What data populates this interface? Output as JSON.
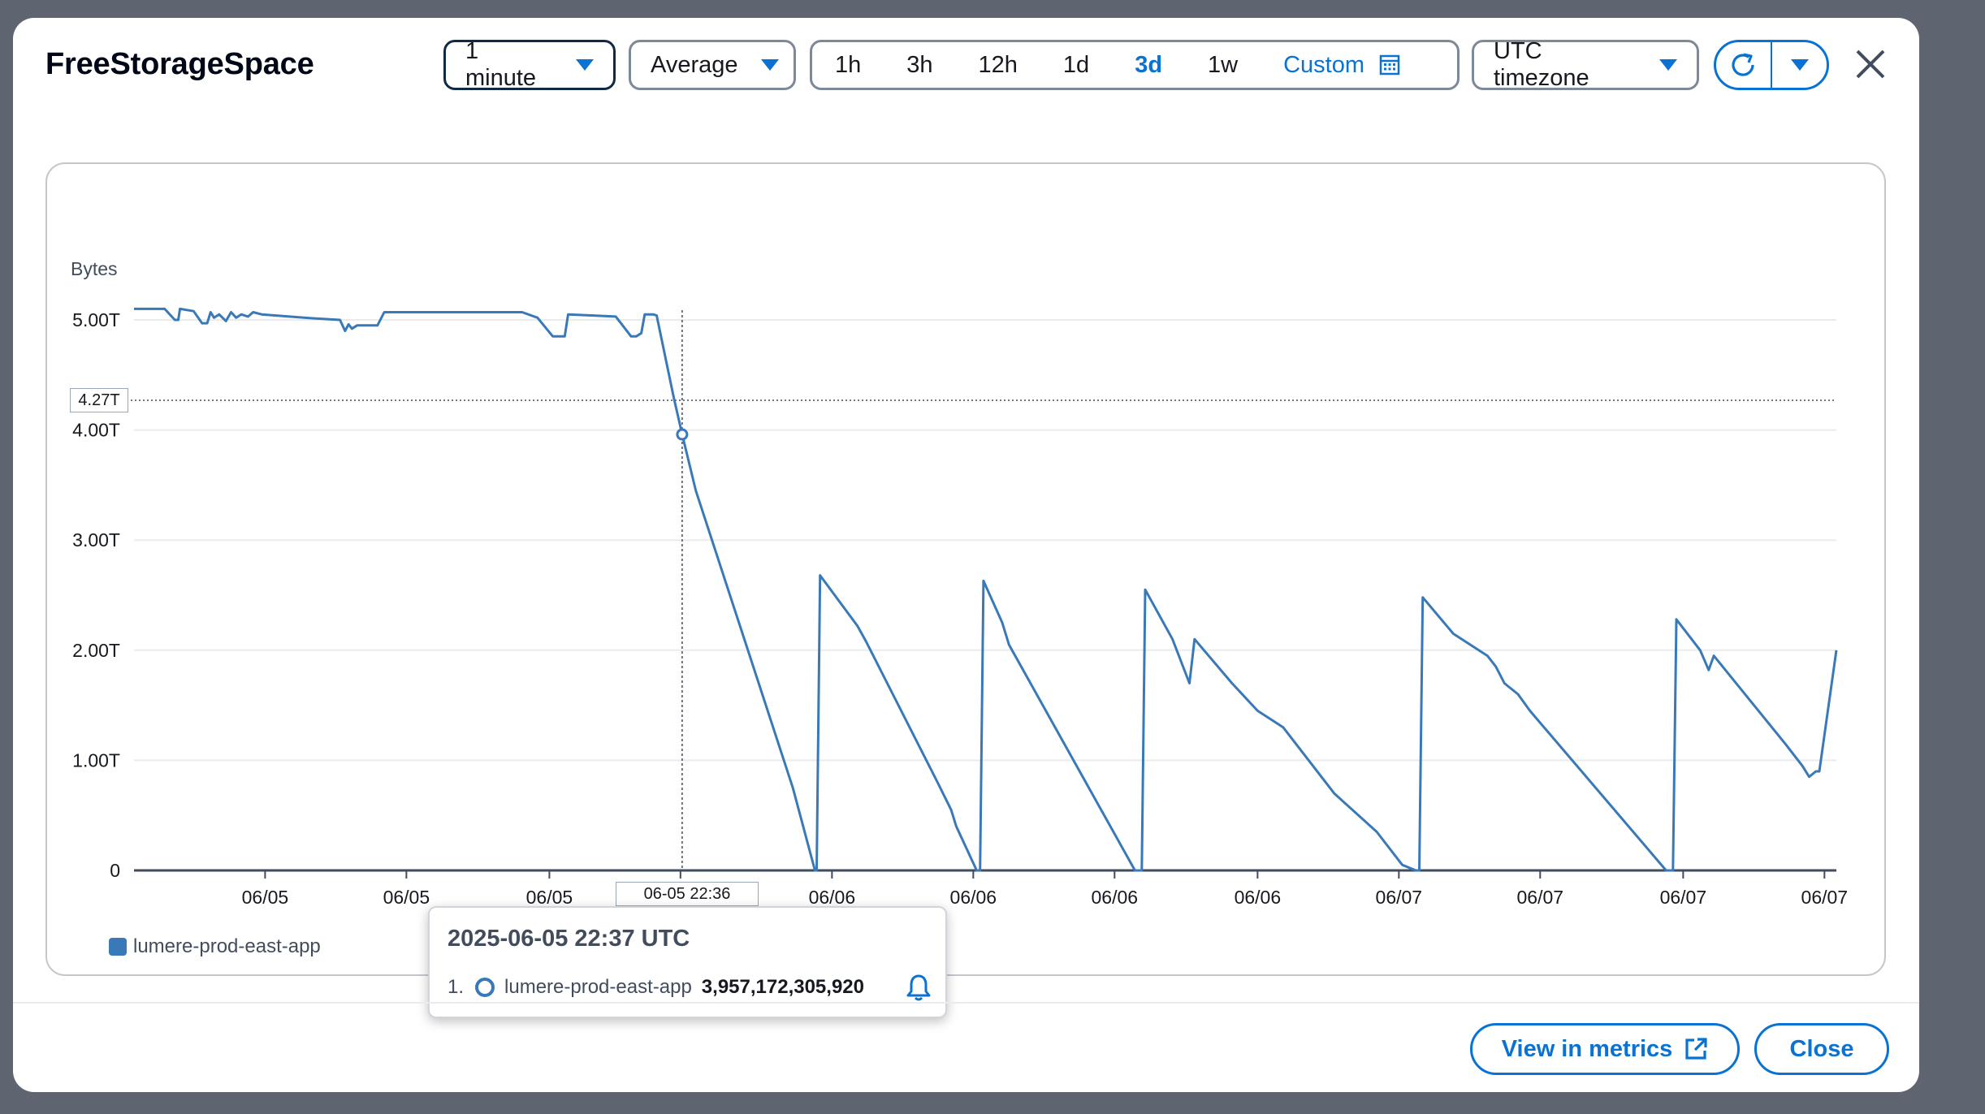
{
  "modal": {
    "title": "FreeStorageSpace"
  },
  "toolbar": {
    "period": "1 minute",
    "statistic": "Average",
    "ranges": [
      "1h",
      "3h",
      "12h",
      "1d",
      "3d",
      "1w"
    ],
    "active_range": "3d",
    "custom_label": "Custom",
    "timezone": "UTC timezone"
  },
  "chart": {
    "y_unit": "Bytes",
    "hover_x_label": "06-05 22:36",
    "hover_y_label": "4.27T",
    "legend": "lumere-prod-east-app"
  },
  "chart_data": {
    "type": "line",
    "ylabel": "Bytes",
    "ylim": [
      0,
      5.0
    ],
    "y_ticks": [
      "0",
      "1.00T",
      "2.00T",
      "3.00T",
      "4.00T",
      "5.00T"
    ],
    "y_tick_values": [
      0,
      1,
      2,
      3,
      4,
      5
    ],
    "x_ticks": [
      "06/05",
      "06/05",
      "06/05",
      "06/05",
      "06/06",
      "06/06",
      "06/06",
      "06/06",
      "06/07",
      "06/07",
      "06/07",
      "06/07"
    ],
    "x_tick_positions": [
      0.077,
      0.16,
      0.244,
      0.321,
      0.41,
      0.493,
      0.576,
      0.66,
      0.743,
      0.826,
      0.91,
      0.993
    ],
    "grid": true,
    "series": [
      {
        "name": "lumere-prod-east-app",
        "color": "#3a79b7",
        "points": [
          [
            0.0,
            5.1
          ],
          [
            0.018,
            5.1
          ],
          [
            0.024,
            5.0
          ],
          [
            0.026,
            5.0
          ],
          [
            0.027,
            5.1
          ],
          [
            0.035,
            5.08
          ],
          [
            0.04,
            4.97
          ],
          [
            0.043,
            4.97
          ],
          [
            0.045,
            5.07
          ],
          [
            0.047,
            5.02
          ],
          [
            0.05,
            5.05
          ],
          [
            0.054,
            4.99
          ],
          [
            0.057,
            5.07
          ],
          [
            0.06,
            5.02
          ],
          [
            0.063,
            5.05
          ],
          [
            0.067,
            5.03
          ],
          [
            0.07,
            5.07
          ],
          [
            0.075,
            5.05
          ],
          [
            0.1,
            5.02
          ],
          [
            0.121,
            5.0
          ],
          [
            0.124,
            4.9
          ],
          [
            0.126,
            4.96
          ],
          [
            0.128,
            4.92
          ],
          [
            0.131,
            4.95
          ],
          [
            0.143,
            4.95
          ],
          [
            0.147,
            5.07
          ],
          [
            0.2,
            5.07
          ],
          [
            0.228,
            5.07
          ],
          [
            0.237,
            5.02
          ],
          [
            0.246,
            4.85
          ],
          [
            0.253,
            4.85
          ],
          [
            0.255,
            5.05
          ],
          [
            0.27,
            5.04
          ],
          [
            0.283,
            5.03
          ],
          [
            0.292,
            4.85
          ],
          [
            0.295,
            4.85
          ],
          [
            0.298,
            4.88
          ],
          [
            0.3,
            5.05
          ],
          [
            0.305,
            5.05
          ],
          [
            0.307,
            5.04
          ],
          [
            0.317,
            4.3
          ],
          [
            0.322,
            3.96
          ],
          [
            0.33,
            3.45
          ],
          [
            0.387,
            0.75
          ],
          [
            0.4,
            0.0
          ],
          [
            0.401,
            0.0
          ],
          [
            0.403,
            2.68
          ],
          [
            0.425,
            2.22
          ],
          [
            0.43,
            2.08
          ],
          [
            0.472,
            0.8
          ],
          [
            0.48,
            0.55
          ],
          [
            0.483,
            0.4
          ],
          [
            0.495,
            0.0
          ],
          [
            0.497,
            0.0
          ],
          [
            0.499,
            2.63
          ],
          [
            0.51,
            2.25
          ],
          [
            0.514,
            2.05
          ],
          [
            0.523,
            1.8
          ],
          [
            0.588,
            0.0
          ],
          [
            0.592,
            0.0
          ],
          [
            0.594,
            2.55
          ],
          [
            0.61,
            2.1
          ],
          [
            0.62,
            1.7
          ],
          [
            0.623,
            2.1
          ],
          [
            0.645,
            1.7
          ],
          [
            0.66,
            1.45
          ],
          [
            0.675,
            1.3
          ],
          [
            0.705,
            0.7
          ],
          [
            0.73,
            0.35
          ],
          [
            0.745,
            0.05
          ],
          [
            0.753,
            0.0
          ],
          [
            0.755,
            0.0
          ],
          [
            0.757,
            2.48
          ],
          [
            0.775,
            2.15
          ],
          [
            0.795,
            1.95
          ],
          [
            0.8,
            1.85
          ],
          [
            0.805,
            1.7
          ],
          [
            0.813,
            1.6
          ],
          [
            0.82,
            1.45
          ],
          [
            0.9,
            0.0
          ],
          [
            0.904,
            0.0
          ],
          [
            0.906,
            2.28
          ],
          [
            0.92,
            2.0
          ],
          [
            0.925,
            1.82
          ],
          [
            0.928,
            1.95
          ],
          [
            0.97,
            1.15
          ],
          [
            0.98,
            0.95
          ],
          [
            0.984,
            0.85
          ],
          [
            0.988,
            0.9
          ],
          [
            0.99,
            0.9
          ],
          [
            1.0,
            2.0
          ]
        ]
      }
    ],
    "hover": {
      "x_pos": 0.322,
      "y": 3.96,
      "crosshair_y": 4.27
    }
  },
  "tooltip": {
    "title": "2025-06-05 22:37 UTC",
    "index": "1.",
    "series": "lumere-prod-east-app",
    "value": "3,957,172,305,920"
  },
  "footer": {
    "view_label": "View in metrics",
    "close_label": "Close"
  },
  "colors": {
    "accent": "#0972d3",
    "series": "#3a79b7",
    "border": "#7d8998"
  }
}
